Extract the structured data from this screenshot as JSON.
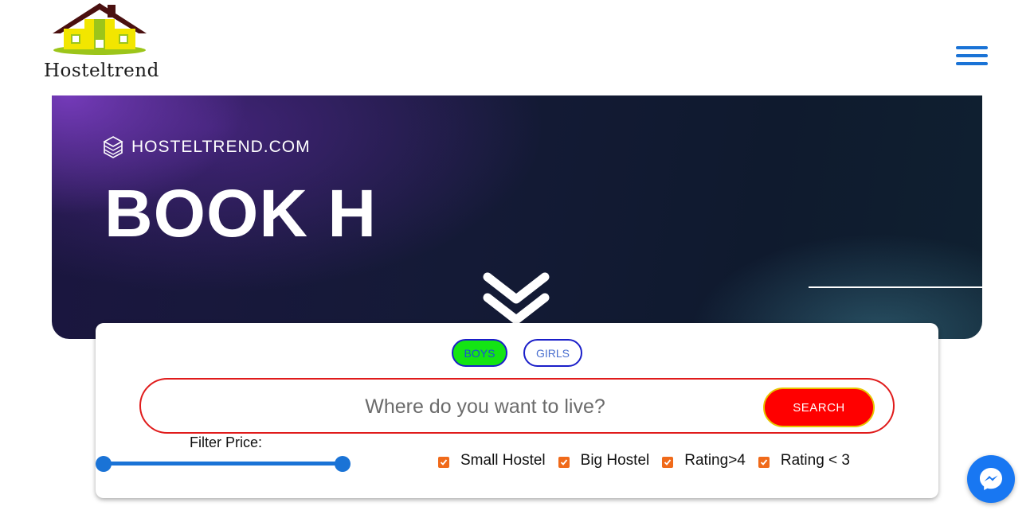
{
  "header": {
    "logo_text": "Hosteltrend",
    "menu_icon": "hamburger-menu-icon"
  },
  "hero": {
    "brand": "HOSTELTREND.COM",
    "heading": "BOOK H",
    "brand_icon": "cube-stack-icon",
    "scroll_icon": "double-chevron-down-icon"
  },
  "search_card": {
    "gender_tabs": [
      {
        "label": "BOYS",
        "selected": true
      },
      {
        "label": "GIRLS",
        "selected": false
      }
    ],
    "search": {
      "placeholder": "Where do you want to live?",
      "value": "",
      "button_label": "SEARCH"
    },
    "filter_price_label": "Filter Price:",
    "price_range": {
      "min_fraction": 0.0,
      "max_fraction": 1.0
    },
    "checkboxes": [
      {
        "label": "Small Hostel",
        "checked": true
      },
      {
        "label": "Big Hostel",
        "checked": true
      },
      {
        "label": "Rating>4",
        "checked": true
      },
      {
        "label": "Rating < 3",
        "checked": true
      }
    ]
  },
  "chat_widget": {
    "icon": "messenger-icon"
  },
  "colors": {
    "accent_blue": "#1a73d6",
    "search_red": "#ff0000",
    "boys_green": "#14e414",
    "checkbox_orange": "#f06a1a",
    "messenger_blue": "#1877f2"
  }
}
